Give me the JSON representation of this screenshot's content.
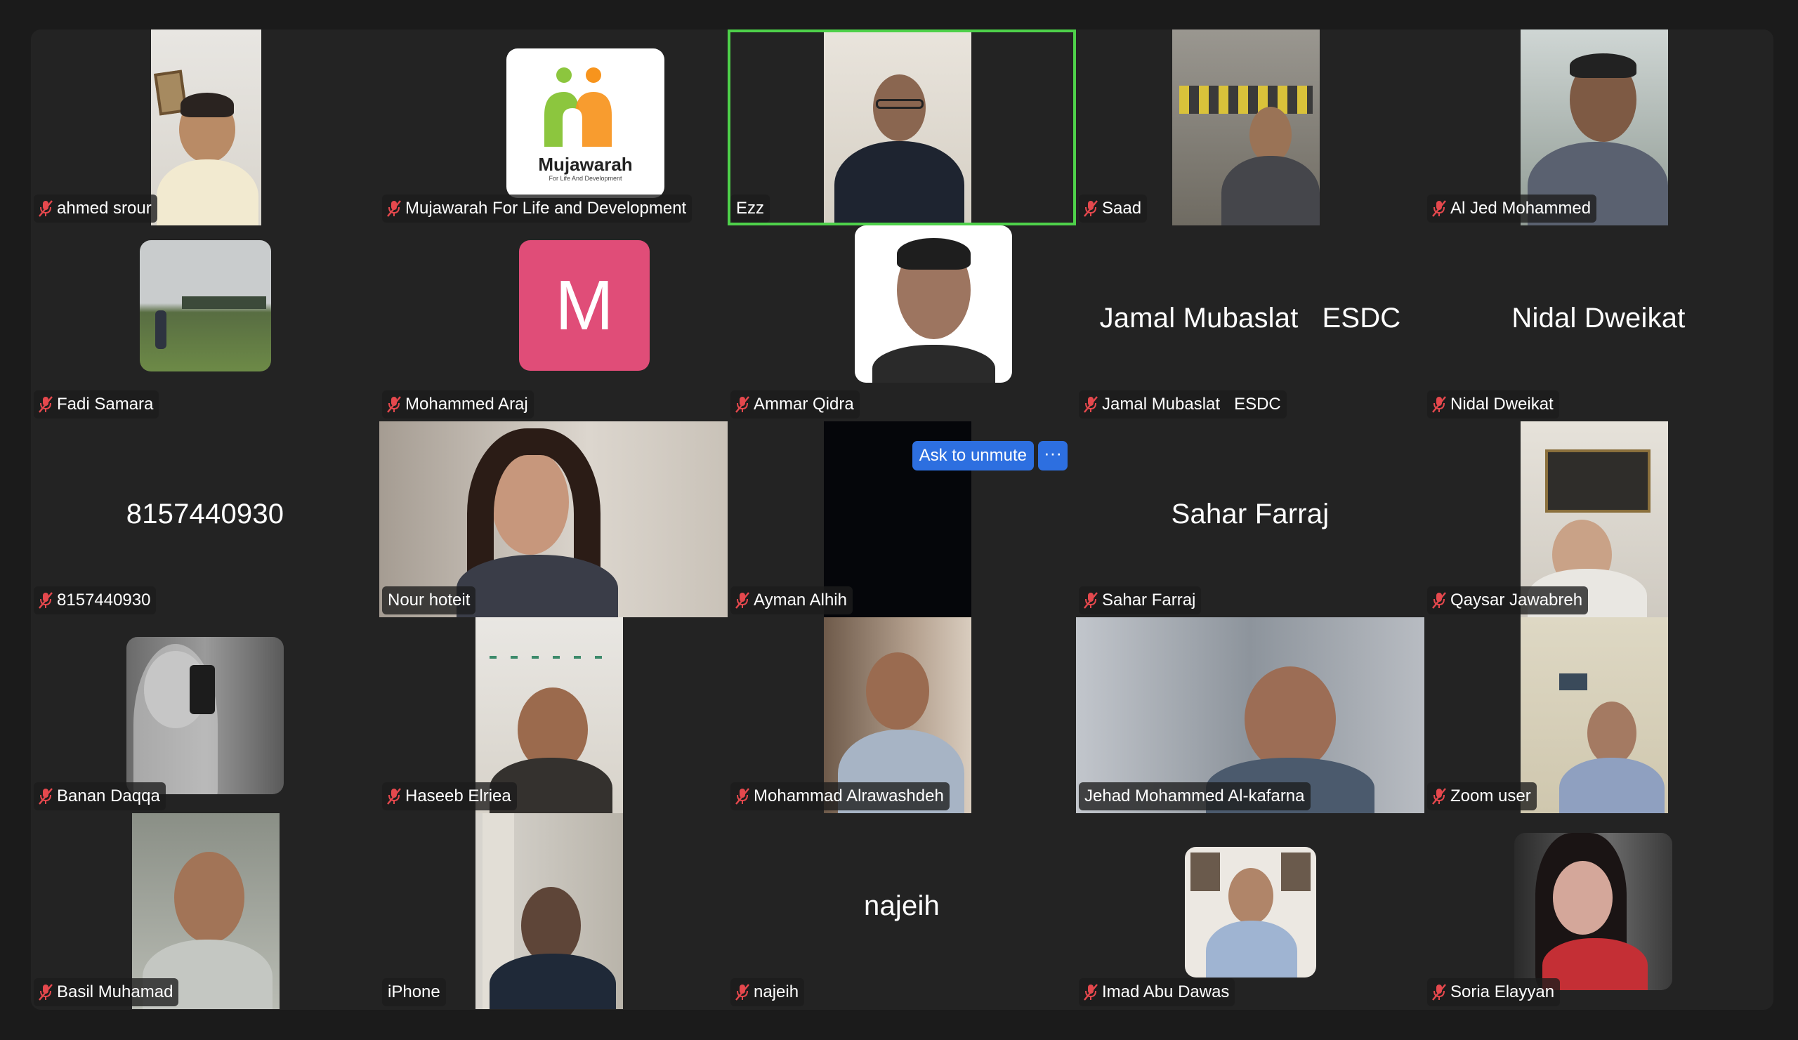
{
  "meeting": {
    "view": "gallery",
    "participants": [
      {
        "name": "ahmed srour",
        "muted": true
      },
      {
        "name": "Mujawarah For Life and Development",
        "muted": true,
        "logo": {
          "title": "Mujawarah",
          "tagline": "For Life And Development"
        }
      },
      {
        "name": "Ezz",
        "muted": false,
        "active_speaker": true
      },
      {
        "name": "Saad",
        "muted": true
      },
      {
        "name": "Al Jed Mohammed",
        "muted": true
      },
      {
        "name": "Fadi Samara",
        "muted": true
      },
      {
        "name": "Mohammed Araj",
        "muted": true,
        "initial": "M"
      },
      {
        "name": "Ammar Qidra",
        "muted": true
      },
      {
        "name": "Jamal Mubaslat   ESDC",
        "muted": true,
        "display_name": "Jamal Mubaslat   ESDC"
      },
      {
        "name": "Nidal Dweikat",
        "muted": true,
        "display_name": "Nidal Dweikat"
      },
      {
        "name": "8157440930",
        "muted": true,
        "display_name": "8157440930"
      },
      {
        "name": "Nour hoteit",
        "muted": false
      },
      {
        "name": "Ayman Alhih",
        "muted": true,
        "ask_to_unmute": "Ask to unmute",
        "more": "···"
      },
      {
        "name": "Sahar Farraj",
        "muted": true,
        "display_name": "Sahar Farraj"
      },
      {
        "name": "Qaysar Jawabreh",
        "muted": true
      },
      {
        "name": "Banan Daqqa",
        "muted": true
      },
      {
        "name": "Haseeb Elriea",
        "muted": true
      },
      {
        "name": "Mohammad Alrawashdeh",
        "muted": true
      },
      {
        "name": "Jehad Mohammed Al-kafarna",
        "muted": false
      },
      {
        "name": "Zoom user",
        "muted": true
      },
      {
        "name": "Basil Muhamad",
        "muted": true
      },
      {
        "name": "iPhone",
        "muted": false
      },
      {
        "name": "najeih",
        "muted": true,
        "display_name": "najeih"
      },
      {
        "name": "Imad Abu Dawas",
        "muted": true
      },
      {
        "name": "Soria Elayyan",
        "muted": true
      }
    ]
  },
  "colors": {
    "active_border": "#4ed14a",
    "muted_mic": "#e5484d",
    "unmute_button": "#2d6fe0",
    "avatar_initial_bg": "#e04d78"
  }
}
